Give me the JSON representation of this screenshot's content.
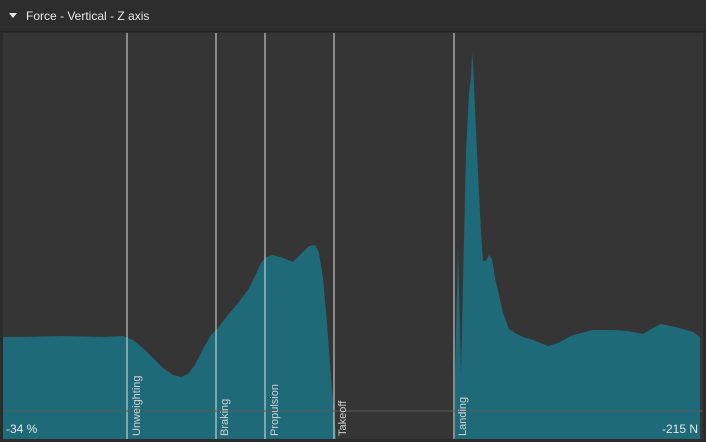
{
  "panel": {
    "title": "Force - Vertical - Z axis",
    "collapse_icon": "caret-down-icon"
  },
  "readouts": {
    "left": "-34 %",
    "right": "-215 N"
  },
  "phases": [
    "Unweighting",
    "Braking",
    "Propulsion",
    "Takeoff",
    "Landing"
  ],
  "colors": {
    "fill": "#1f6a78",
    "plot_background": "#353535",
    "marker_line": "#e0e0e0"
  }
}
